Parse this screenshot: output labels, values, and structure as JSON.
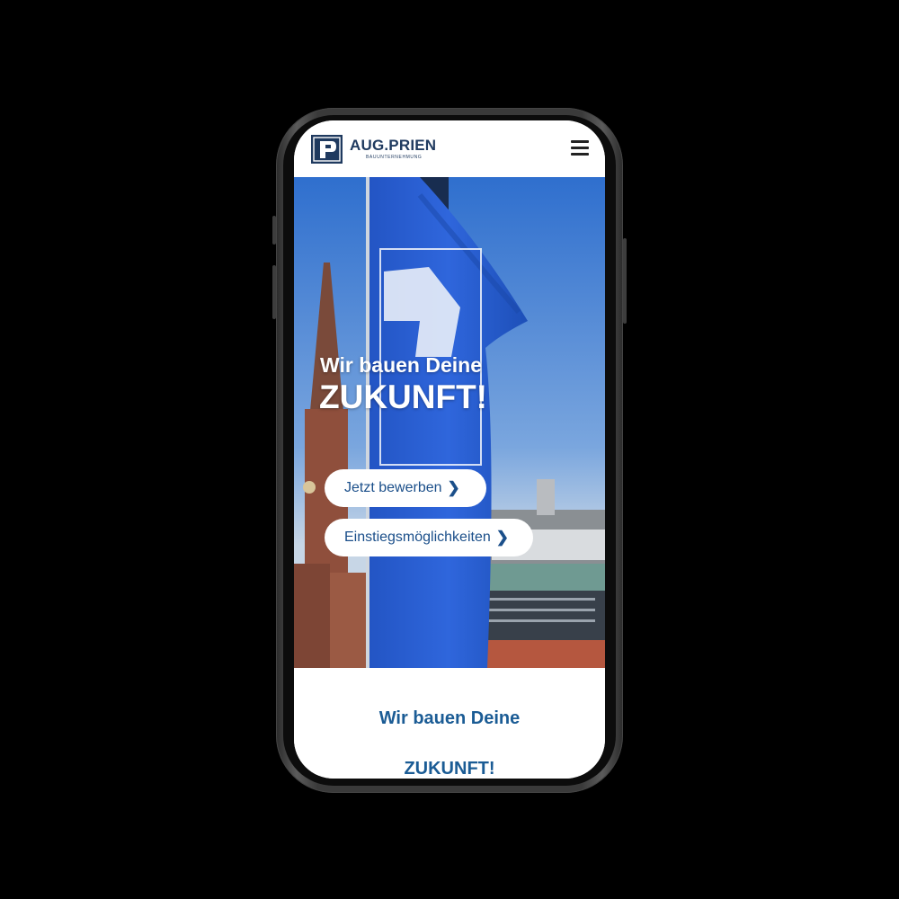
{
  "header": {
    "logo_title": "AUG.PRIEN",
    "logo_subtitle": "BAUUNTERNEHMUNG",
    "logo_icon": "p-logo-icon",
    "menu_icon": "hamburger-menu-icon"
  },
  "hero": {
    "headline_line1": "Wir bauen Deine",
    "headline_line2": "ZUKUNFT!",
    "buttons": [
      {
        "label": "Jetzt bewerben",
        "icon": "chevron-right-icon"
      },
      {
        "label": "Einstiegsmöglichkeiten",
        "icon": "chevron-right-icon"
      }
    ]
  },
  "content": {
    "heading_line1": "Wir bauen Deine",
    "heading_line2": "ZUKUNFT!"
  },
  "colors": {
    "brand_blue": "#1b5c95",
    "logo_navy": "#1f3a5f",
    "flag_blue": "#2a5fd6",
    "sky_blue": "#5b8fd6"
  }
}
